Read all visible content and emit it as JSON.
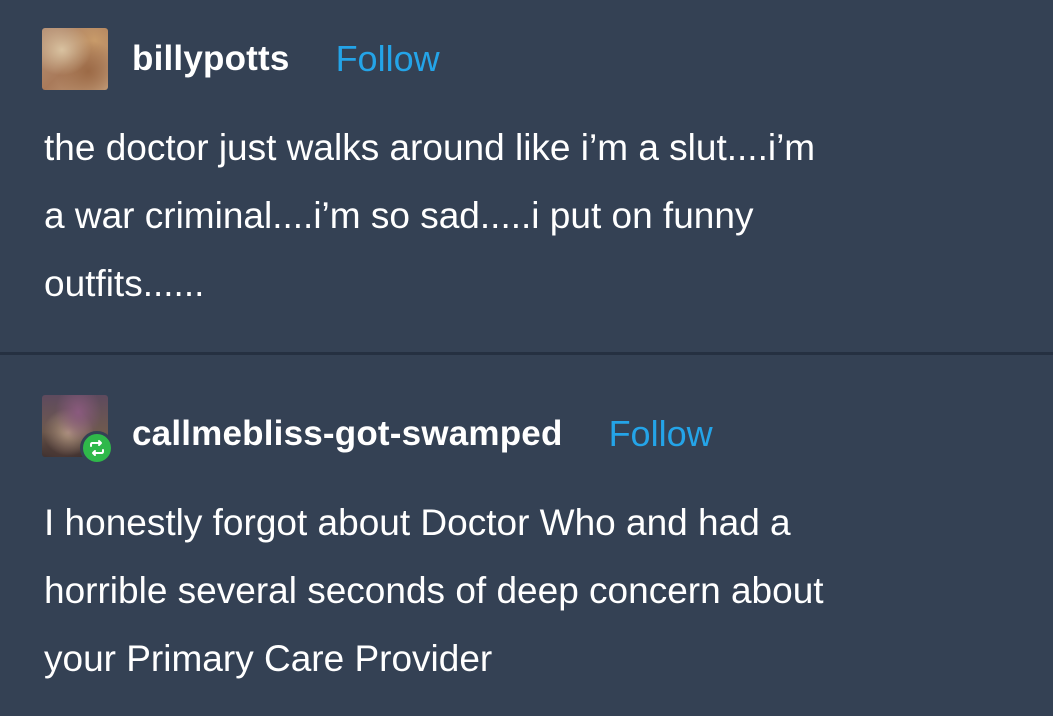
{
  "posts": [
    {
      "username": "billypotts",
      "follow_label": "Follow",
      "avatar_icon": "user-avatar",
      "body_lines": [
        "the doctor just walks around like i’m a slut....i’m",
        "a war criminal....i’m so sad.....i put on funny",
        "outfits......"
      ]
    },
    {
      "username": "callmebliss-got-swamped",
      "follow_label": "Follow",
      "avatar_icon": "user-avatar",
      "badge_icon": "reblog-icon",
      "body_lines": [
        "I honestly forgot about Doctor Who and had a",
        "horrible several seconds of deep concern about",
        "your Primary Care Provider"
      ]
    }
  ],
  "colors": {
    "background": "#344154",
    "follow": "#24a4e8",
    "reblog_badge": "#2fb84a",
    "text": "#ffffff"
  }
}
